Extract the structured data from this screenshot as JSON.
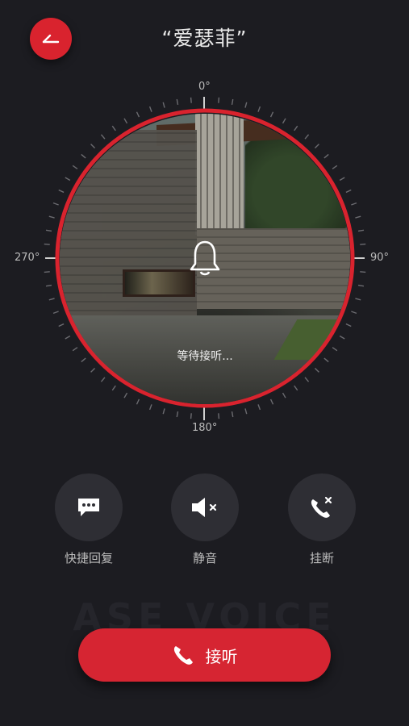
{
  "header": {
    "title": "“爱瑟菲”"
  },
  "dial": {
    "deg_top": "0°",
    "deg_right": "90°",
    "deg_bottom": "180°",
    "deg_left": "270°",
    "progress_fraction": 0.08
  },
  "view": {
    "status": "等待接听..."
  },
  "actions": [
    {
      "label": "快捷回复",
      "icon": "message-icon"
    },
    {
      "label": "静音",
      "icon": "mute-icon"
    },
    {
      "label": "挂断",
      "icon": "hangup-icon"
    }
  ],
  "watermark": "ASE VOICE",
  "answer": {
    "label": "接听"
  },
  "colors": {
    "accent": "#d9232e",
    "background": "#1c1c21",
    "button_bg": "#2e2e34"
  }
}
